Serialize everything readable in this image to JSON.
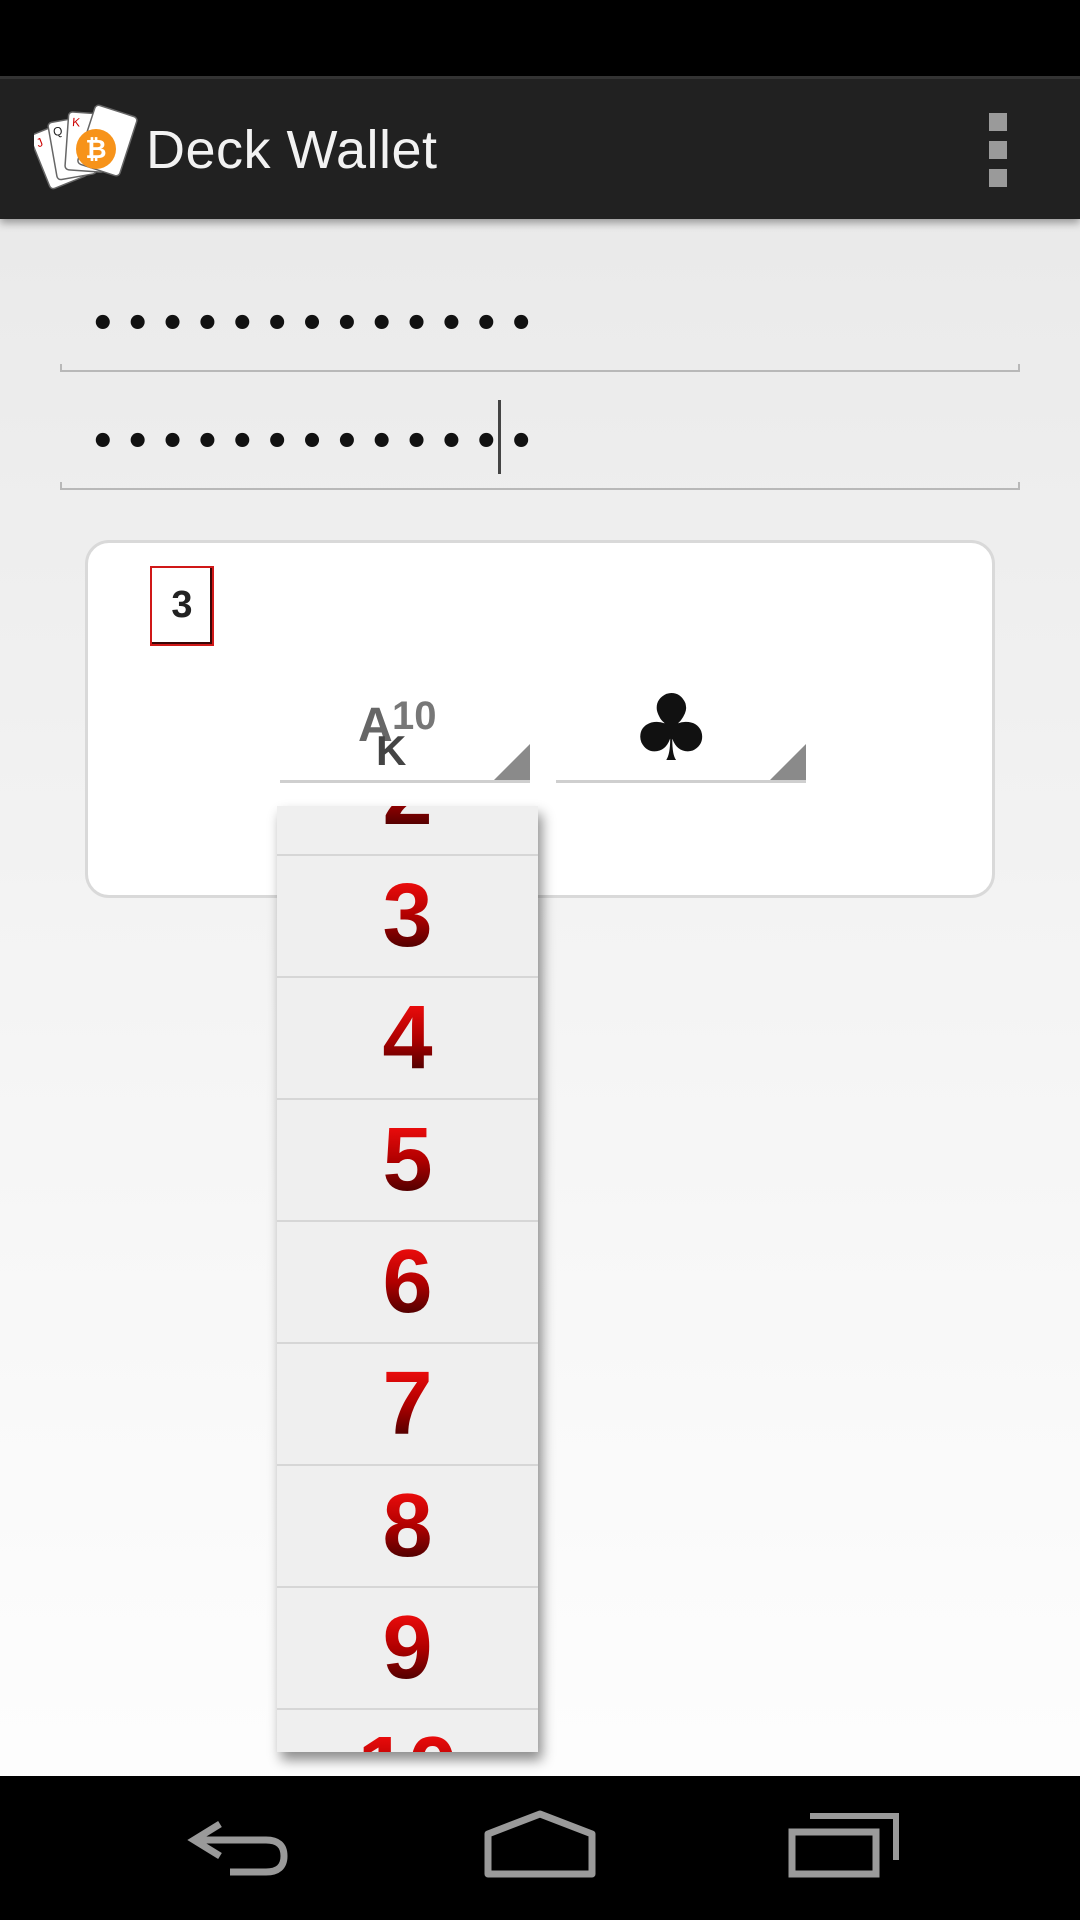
{
  "app": {
    "title": "Deck Wallet",
    "icon": "deck-wallet-bitcoin-cards-logo",
    "overflow_icon": "overflow-menu-icon"
  },
  "fields": {
    "password1": {
      "value": "•••••••••••••",
      "masked_length": 13
    },
    "password2": {
      "value": "•••••••••••••",
      "masked_length": 13,
      "focused": true
    }
  },
  "card_picker": {
    "selected_card_label": "3",
    "selected_card_color": "#d01818",
    "rank_spinner": {
      "icon": "rank-ak10-icon"
    },
    "suit_spinner": {
      "icon": "clubs-icon",
      "glyph": "♣"
    }
  },
  "rank_dropdown": {
    "partial_top": "2",
    "items": [
      "3",
      "4",
      "5",
      "6",
      "7",
      "8",
      "9"
    ],
    "partial_bottom": "10",
    "text_color": "#d00000"
  },
  "nav": {
    "back_icon": "back-icon",
    "home_icon": "home-icon",
    "recents_icon": "recents-icon"
  }
}
